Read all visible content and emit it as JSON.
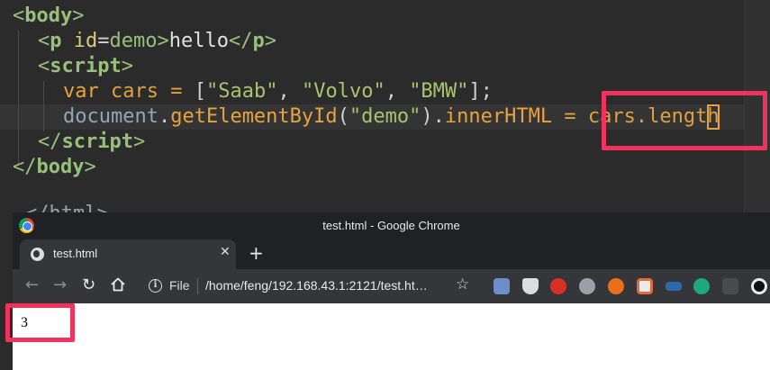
{
  "editor": {
    "lines": {
      "body_open": "body",
      "p_tag": "p",
      "p_attr": "id",
      "p_attr_value": "demo",
      "p_text": "hello",
      "p_close": "p",
      "script_open": "script",
      "var_kw": "var",
      "var_name": "cars",
      "str1": "\"Saab\"",
      "str2": "\"Volvo\"",
      "str3": "\"BMW\"",
      "doc_obj": "document",
      "method": "getElementById",
      "arg": "\"demo\"",
      "prop": "innerHTML",
      "rhs_a": "cars.lengt",
      "rhs_caret": "h",
      "script_close": "script",
      "body_close": "body",
      "partial": "</html>"
    }
  },
  "chrome": {
    "window_title": "test.html - Google Chrome",
    "tab_title": "test.html",
    "tab_close": "✕",
    "new_tab": "+",
    "omnibox": {
      "scheme_label": "File",
      "url": "/home/feng/192.168.43.1:2121/test.ht…"
    },
    "extensions": [
      "ext-1",
      "ext-2",
      "ext-3",
      "ext-4",
      "ext-5",
      "ext-6",
      "ext-7",
      "ext-8",
      "ext-9",
      "ext-10"
    ],
    "page_output": "3"
  },
  "colors": {
    "highlight": "#f0335c",
    "editor_bg": "#2b2b2b",
    "chrome_bg": "#202124",
    "toolbar_bg": "#35363a"
  }
}
